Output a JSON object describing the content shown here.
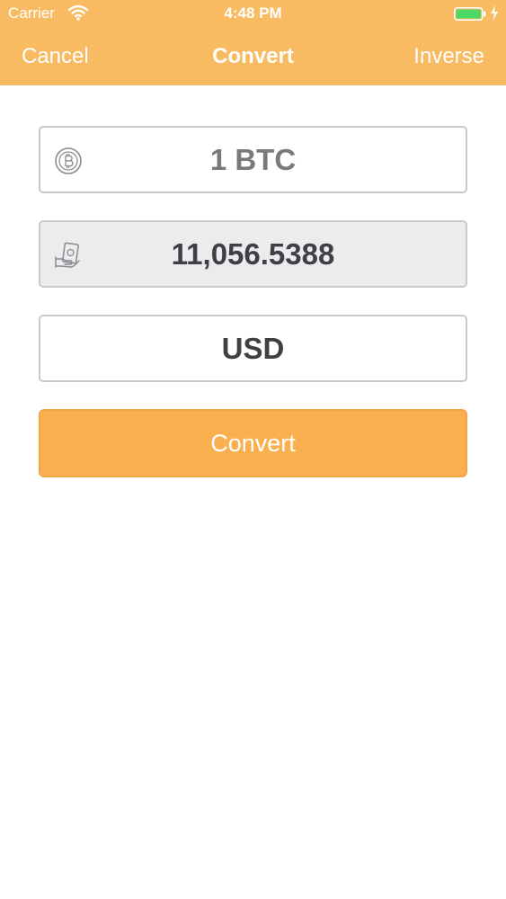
{
  "status_bar": {
    "carrier": "Carrier",
    "time": "4:48 PM",
    "icons": [
      "wifi-icon",
      "battery-icon",
      "charging-bolt-icon"
    ]
  },
  "nav": {
    "left_label": "Cancel",
    "title": "Convert",
    "right_label": "Inverse"
  },
  "form": {
    "amount": {
      "value": "1 BTC",
      "icon": "bitcoin-icon"
    },
    "result": {
      "value": "11,056.5388",
      "icon": "money-hand-icon"
    },
    "currency": {
      "value": "USD"
    }
  },
  "convert_button": {
    "label": "Convert"
  },
  "colors": {
    "header": "#f8bb62",
    "button": "#fbb04f",
    "field_border": "#c9c9c9",
    "result_background": "#ececee"
  }
}
